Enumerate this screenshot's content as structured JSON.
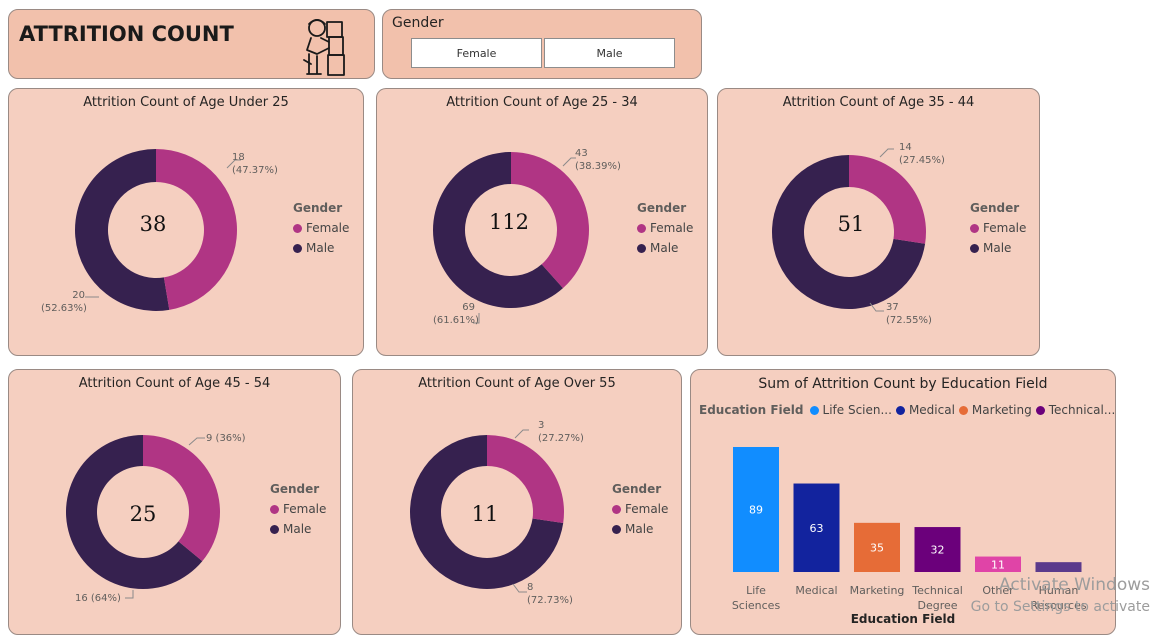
{
  "app": {
    "title": "ATTRITION COUNT",
    "logo_icon": "worker-carrying-boxes-icon"
  },
  "slicer": {
    "label": "Gender",
    "options": [
      "Female",
      "Male"
    ]
  },
  "colors": {
    "female": "#b03584",
    "male": "#36214f",
    "card_bg": "#f5cfc0"
  },
  "donuts": [
    {
      "title": "Attrition Count of Age Under 25",
      "total": "38",
      "female_label": "18",
      "female_pct": "(47.37%)",
      "male_label": "20",
      "male_pct": "(52.63%)",
      "legend_title": "Gender",
      "legend_female": "Female",
      "legend_male": "Male"
    },
    {
      "title": "Attrition Count of Age 25 - 34",
      "total": "112",
      "female_label": "43",
      "female_pct": "(38.39%)",
      "male_label": "69",
      "male_pct": "(61.61%)",
      "legend_title": "Gender",
      "legend_female": "Female",
      "legend_male": "Male"
    },
    {
      "title": "Attrition Count of Age 35 - 44",
      "total": "51",
      "female_label": "14",
      "female_pct": "(27.45%)",
      "male_label": "37",
      "male_pct": "(72.55%)",
      "legend_title": "Gender",
      "legend_female": "Female",
      "legend_male": "Male"
    },
    {
      "title": "Attrition Count of Age 45 - 54",
      "total": "25",
      "female_label": "9 (36%)",
      "female_pct": "",
      "male_label": "16 (64%)",
      "male_pct": "",
      "legend_title": "Gender",
      "legend_female": "Female",
      "legend_male": "Male"
    },
    {
      "title": "Attrition Count of Age Over 55",
      "total": "11",
      "female_label": "3",
      "female_pct": "(27.27%)",
      "male_label": "8",
      "male_pct": "(72.73%)",
      "legend_title": "Gender",
      "legend_female": "Female",
      "legend_male": "Male"
    }
  ],
  "edu": {
    "title": "Sum of Attrition Count by Education Field",
    "legend_title": "Education Field",
    "legend_items": [
      {
        "label": "Life Scien...",
        "color": "#118dff"
      },
      {
        "label": "Medical",
        "color": "#12239e"
      },
      {
        "label": "Marketing",
        "color": "#e66c37"
      },
      {
        "label": "Technical...",
        "color": "#6b007b"
      }
    ],
    "xlabel": "Education Field"
  },
  "chart_data": [
    {
      "type": "pie",
      "title": "Attrition Count of Age Under 25",
      "labels": [
        "Female",
        "Male"
      ],
      "values": [
        18,
        20
      ],
      "percent": [
        47.37,
        52.63
      ],
      "total": 38,
      "legend_title": "Gender",
      "legend_position": "right"
    },
    {
      "type": "pie",
      "title": "Attrition Count of Age 25 - 34",
      "labels": [
        "Female",
        "Male"
      ],
      "values": [
        43,
        69
      ],
      "percent": [
        38.39,
        61.61
      ],
      "total": 112,
      "legend_title": "Gender",
      "legend_position": "right"
    },
    {
      "type": "pie",
      "title": "Attrition Count of Age 35 - 44",
      "labels": [
        "Female",
        "Male"
      ],
      "values": [
        14,
        37
      ],
      "percent": [
        27.45,
        72.55
      ],
      "total": 51,
      "legend_title": "Gender",
      "legend_position": "right"
    },
    {
      "type": "pie",
      "title": "Attrition Count of Age 45 - 54",
      "labels": [
        "Female",
        "Male"
      ],
      "values": [
        9,
        16
      ],
      "percent": [
        36,
        64
      ],
      "total": 25,
      "legend_title": "Gender",
      "legend_position": "right"
    },
    {
      "type": "pie",
      "title": "Attrition Count of Age Over 55",
      "labels": [
        "Female",
        "Male"
      ],
      "values": [
        3,
        8
      ],
      "percent": [
        27.27,
        72.73
      ],
      "total": 11,
      "legend_title": "Gender",
      "legend_position": "right"
    },
    {
      "type": "bar",
      "title": "Sum of Attrition Count by Education Field",
      "categories": [
        [
          "Life",
          "Sciences"
        ],
        [
          "Medical"
        ],
        [
          "Marketing"
        ],
        [
          "Technical",
          "Degree"
        ],
        [
          "Other"
        ],
        [
          "Human",
          "Resources"
        ]
      ],
      "values": [
        89,
        63,
        35,
        32,
        11,
        7
      ],
      "value_labels": [
        "89",
        "63",
        "35",
        "32",
        "11",
        ""
      ],
      "colors": [
        "#118dff",
        "#12239e",
        "#e66c37",
        "#6b007b",
        "#e044a7",
        "#5b3a8c"
      ],
      "xlabel": "Education Field",
      "ylabel": "",
      "ylim": [
        0,
        89
      ],
      "grid": false,
      "legend_position": "top-left"
    }
  ],
  "watermark": {
    "line1": "Activate Windows",
    "line2": "Go to Settings to activate"
  }
}
